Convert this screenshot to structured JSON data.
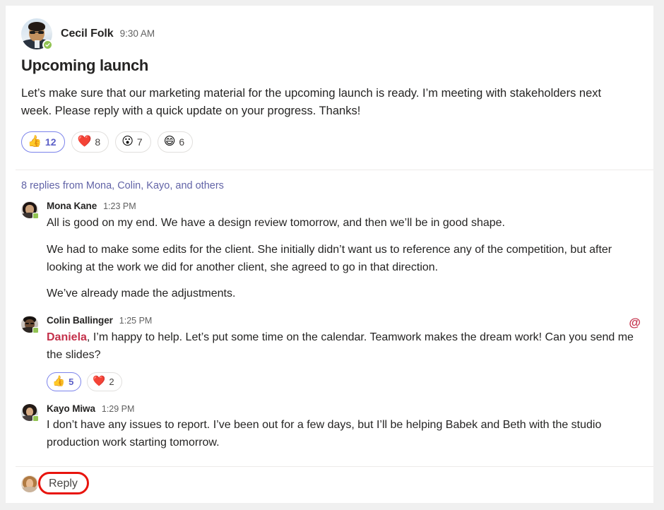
{
  "card": {
    "background": "#ffffff",
    "page_background": "#f0f0f0"
  },
  "root_post": {
    "author": "Cecil Folk",
    "timestamp": "9:30 AM",
    "presence": "available",
    "presence_icon": "check-icon",
    "title": "Upcoming launch",
    "body": "Let’s make sure that our marketing material for the upcoming launch is ready. I’m meeting with stakeholders next week. Please reply with a quick update on your progress. Thanks!",
    "reactions": [
      {
        "emoji": "👍",
        "name": "thumbs-up",
        "count": "12",
        "reacted": true
      },
      {
        "emoji": "❤️",
        "name": "heart",
        "count": "8",
        "reacted": false
      },
      {
        "emoji": "😮",
        "name": "surprised",
        "count": "7",
        "reacted": false
      },
      {
        "emoji": "😄",
        "name": "laugh",
        "count": "6",
        "reacted": false
      }
    ]
  },
  "replies_summary": "8 replies from Mona, Colin, Kayo, and others",
  "replies": [
    {
      "author": "Mona Kane",
      "timestamp": "1:23 PM",
      "paragraphs": [
        "All is good on my end. We have a design review tomorrow, and then we’ll be in good shape.",
        "We had to make some edits for the client. She initially didn’t want us to reference any of the competition, but after looking at the work we did for another client, she agreed to go in that direction.",
        "We’ve already made the adjustments."
      ],
      "mention": null,
      "mention_flag": null,
      "reactions": []
    },
    {
      "author": "Colin Ballinger",
      "timestamp": "1:25 PM",
      "paragraphs": [
        ", I’m happy to help. Let’s put some time on the calendar. Teamwork makes the dream work! Can you send me the slides?"
      ],
      "mention": "Daniela",
      "mention_flag": "@",
      "reactions": [
        {
          "emoji": "👍",
          "name": "thumbs-up",
          "count": "5",
          "reacted": true
        },
        {
          "emoji": "❤️",
          "name": "heart",
          "count": "2",
          "reacted": false
        }
      ]
    },
    {
      "author": "Kayo Miwa",
      "timestamp": "1:29 PM",
      "paragraphs": [
        "I don’t have any issues to report. I’ve been out for a few days, but I’ll be helping Babek and Beth with the studio production work starting tomorrow."
      ],
      "mention": null,
      "mention_flag": null,
      "reactions": []
    }
  ],
  "reply_bar": {
    "label": "Reply",
    "annotated": true,
    "annotation_color": "#e8140d"
  },
  "colors": {
    "mention": "#c4314b",
    "link": "#6264a7",
    "reacted_border": "#7b83eb",
    "reacted_text": "#5b5fc7",
    "presence_green": "#92c353",
    "text_primary": "#252423",
    "text_secondary": "#616161",
    "divider": "#edebe9"
  }
}
